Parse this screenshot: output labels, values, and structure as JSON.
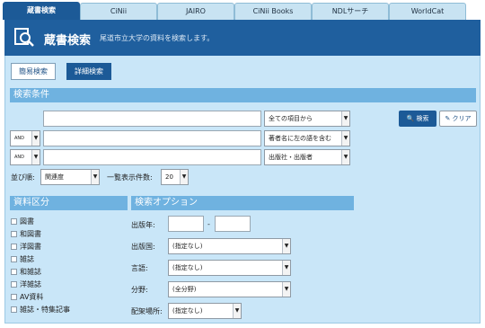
{
  "tabs": [
    "蔵書検索",
    "CiNii",
    "JAIRO",
    "CiNii Books",
    "NDLサーチ",
    "WorldCat"
  ],
  "header": {
    "title": "蔵書検索",
    "subtitle": "尾道市立大学の資料を検索します。",
    "icon": "search-book-icon"
  },
  "modes": {
    "simple": "簡易検索",
    "detail": "詳細検索"
  },
  "conditions": {
    "title": "検索条件",
    "rows": [
      {
        "operator": "",
        "value": "",
        "field": "全ての項目から"
      },
      {
        "operator": "AND",
        "value": "",
        "field": "著者名に左の語を含む"
      },
      {
        "operator": "AND",
        "value": "",
        "field": "出版社・出版者"
      }
    ],
    "search_button": "検索",
    "clear_button": "クリア",
    "sort_label": "並び順:",
    "sort_value": "関連度",
    "per_page_label": "一覧表示件数:",
    "per_page_value": "20"
  },
  "material": {
    "title": "資料区分",
    "items": [
      "図書",
      "和図書",
      "洋図書",
      "雑誌",
      "和雑誌",
      "洋雑誌",
      "AV資料",
      "雑誌・特集記事"
    ]
  },
  "options": {
    "title": "検索オプション",
    "year_label": "出版年:",
    "year_from": "",
    "year_sep": "-",
    "year_to": "",
    "country_label": "出版国:",
    "country_value": "(指定なし)",
    "language_label": "言語:",
    "language_value": "(指定なし)",
    "field_label": "分野:",
    "field_value": "(全分野)",
    "location_label": "配架場所:",
    "location_value": "(指定なし)"
  },
  "colors": {
    "primary": "#1f5f9e",
    "panel": "#c9e6f8",
    "section": "#6fb2e0"
  }
}
